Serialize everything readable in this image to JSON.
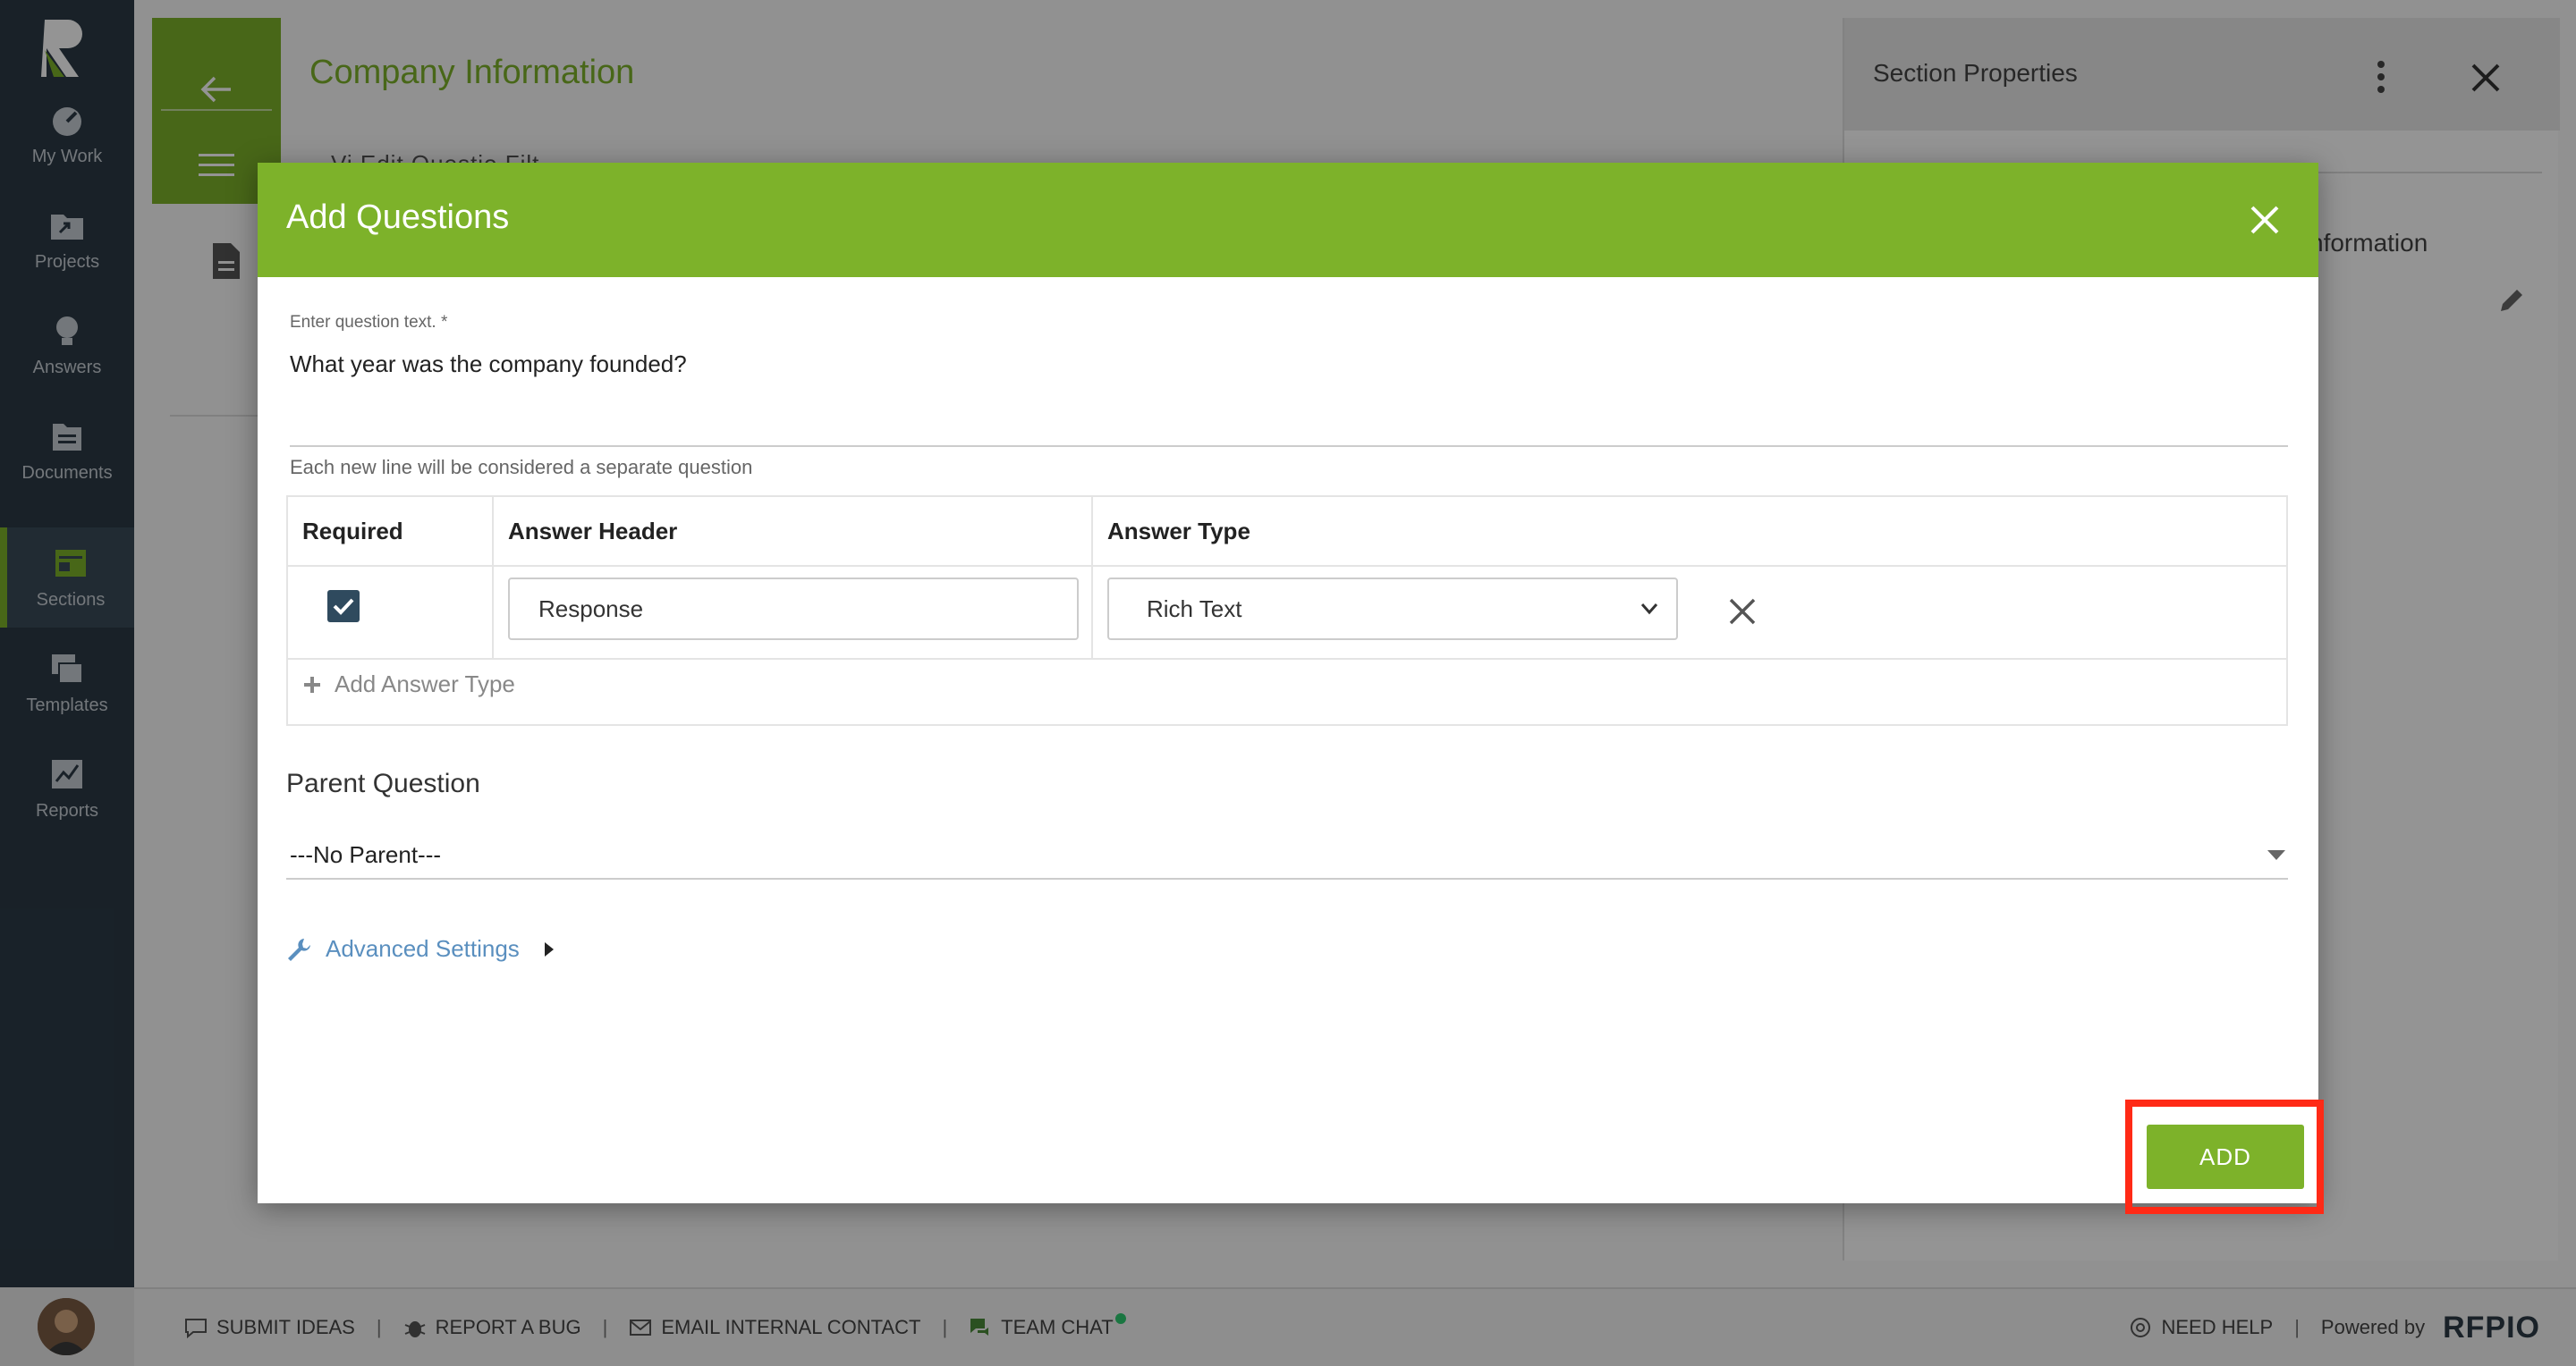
{
  "sidebar": {
    "items": [
      {
        "label": "My Work",
        "icon": "gauge-icon"
      },
      {
        "label": "Projects",
        "icon": "folder-share-icon"
      },
      {
        "label": "Answers",
        "icon": "lightbulb-icon"
      },
      {
        "label": "Documents",
        "icon": "documents-icon"
      },
      {
        "label": "Sections",
        "icon": "sections-icon",
        "active": true
      },
      {
        "label": "Templates",
        "icon": "templates-icon"
      },
      {
        "label": "Reports",
        "icon": "reports-icon"
      }
    ]
  },
  "page": {
    "title": "Company Information",
    "tabs_fragment": "Vi     Edit     Questio     Filt"
  },
  "section_properties": {
    "title": "Section Properties",
    "info_text": "nformation"
  },
  "modal": {
    "title": "Add Questions",
    "question_label": "Enter question text. *",
    "question_text": "What year was the company founded?",
    "hint": "Each new line will be considered a separate question",
    "table": {
      "headers": [
        "Required",
        "Answer Header",
        "Answer Type"
      ],
      "rows": [
        {
          "required": true,
          "answer_header": "Response",
          "answer_type": "Rich Text"
        }
      ],
      "add_answer_label": "Add Answer Type"
    },
    "parent_label": "Parent Question",
    "parent_value": "---No Parent---",
    "advanced_label": "Advanced Settings",
    "add_button": "ADD"
  },
  "footer": {
    "items": [
      "SUBMIT IDEAS",
      "REPORT A BUG",
      "EMAIL INTERNAL CONTACT",
      "TEAM CHAT"
    ],
    "need_help": "NEED HELP",
    "powered_by": "Powered by",
    "brand": "RFPIO"
  },
  "colors": {
    "accent": "#7db22a",
    "sidebar": "#2b3a46",
    "highlight": "#ff2a16",
    "link": "#5a8fbf"
  }
}
